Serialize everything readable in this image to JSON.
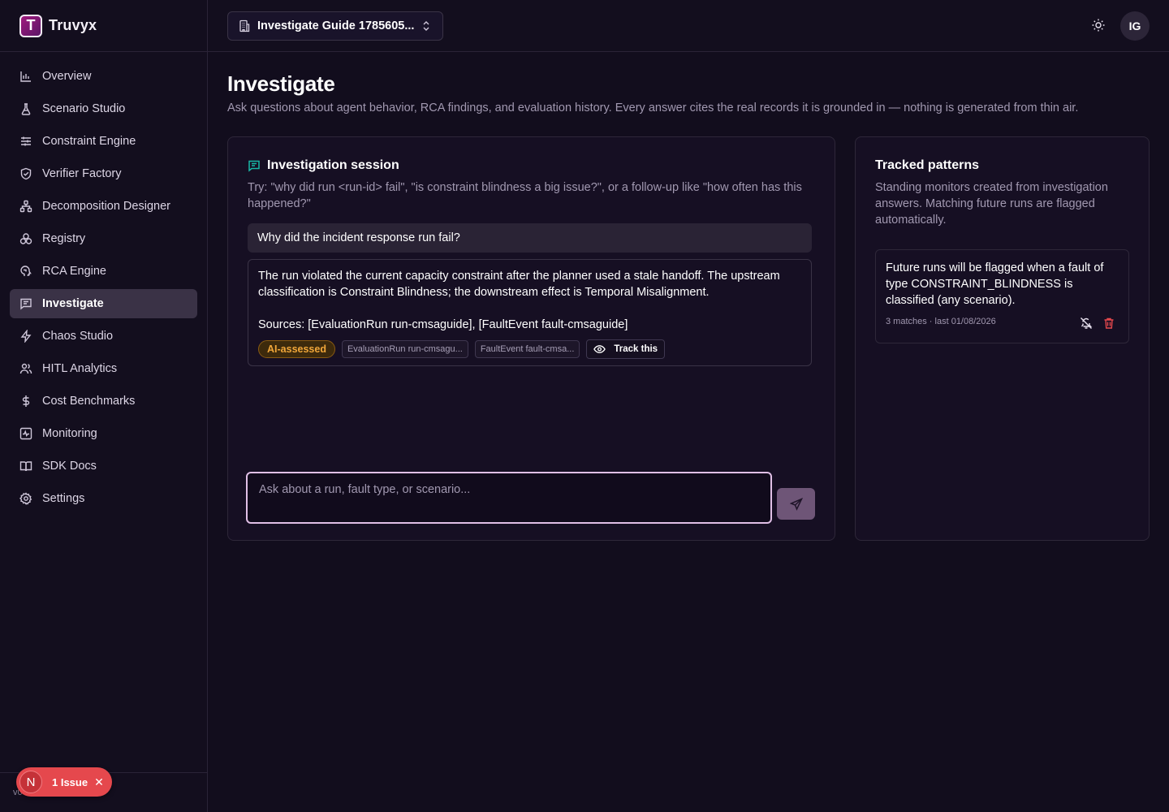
{
  "brand": {
    "name": "Truvyx",
    "logo_letter": "T"
  },
  "nav": {
    "items": [
      {
        "label": "Overview",
        "icon": "bar-chart-icon",
        "active": false
      },
      {
        "label": "Scenario Studio",
        "icon": "flask-icon",
        "active": false
      },
      {
        "label": "Constraint Engine",
        "icon": "sliders-icon",
        "active": false
      },
      {
        "label": "Verifier Factory",
        "icon": "shield-check-icon",
        "active": false
      },
      {
        "label": "Decomposition Designer",
        "icon": "network-icon",
        "active": false
      },
      {
        "label": "Registry",
        "icon": "boxes-icon",
        "active": false
      },
      {
        "label": "RCA Engine",
        "icon": "brain-icon",
        "active": false
      },
      {
        "label": "Investigate",
        "icon": "message-icon",
        "active": true
      },
      {
        "label": "Chaos Studio",
        "icon": "bolt-icon",
        "active": false
      },
      {
        "label": "HITL Analytics",
        "icon": "users-icon",
        "active": false
      },
      {
        "label": "Cost Benchmarks",
        "icon": "dollar-icon",
        "active": false
      },
      {
        "label": "Monitoring",
        "icon": "activity-icon",
        "active": false
      },
      {
        "label": "SDK Docs",
        "icon": "book-icon",
        "active": false
      },
      {
        "label": "Settings",
        "icon": "gear-icon",
        "active": false
      }
    ]
  },
  "footer": {
    "version": "v0",
    "issue_avatar": "N",
    "issue_label": "1 Issue",
    "close": "✕"
  },
  "topbar": {
    "workspace": "Investigate Guide 1785605...",
    "avatar_initials": "IG"
  },
  "page": {
    "title": "Investigate",
    "subtitle": "Ask questions about agent behavior, RCA findings, and evaluation history. Every answer cites the real records it is grounded in — nothing is generated from thin air."
  },
  "session": {
    "title": "Investigation session",
    "hint": "Try: \"why did run <run-id> fail\", \"is constraint blindness a big issue?\", or a follow-up like \"how often has this happened?\"",
    "question": "Why did the incident response run fail?",
    "answer_p1": "The run violated the current capacity constraint after the planner used a stale handoff. The upstream classification is Constraint Blindness; the downstream effect is Temporal Misalignment.",
    "answer_p2": "Sources: [EvaluationRun run-cmsaguide], [FaultEvent fault-cmsaguide]",
    "chip_ai": "AI-assessed",
    "chip_src1": "EvaluationRun run-cmsagu...",
    "chip_src2": "FaultEvent fault-cmsa...",
    "chip_track": "Track this",
    "input_placeholder": "Ask about a run, fault type, or scenario..."
  },
  "patterns": {
    "title": "Tracked patterns",
    "desc": "Standing monitors created from investigation answers. Matching future runs are flagged automatically.",
    "items": [
      {
        "text": "Future runs will be flagged when a fault of type CONSTRAINT_BLINDNESS is classified (any scenario).",
        "meta": "3 matches · last 01/08/2026"
      }
    ]
  },
  "colors": {
    "accent_teal": "#19b8a6",
    "active_nav": "#3a3246",
    "ai_chip": "#f1a73a",
    "danger": "#e5484d",
    "input_border": "#e0bfe6"
  }
}
